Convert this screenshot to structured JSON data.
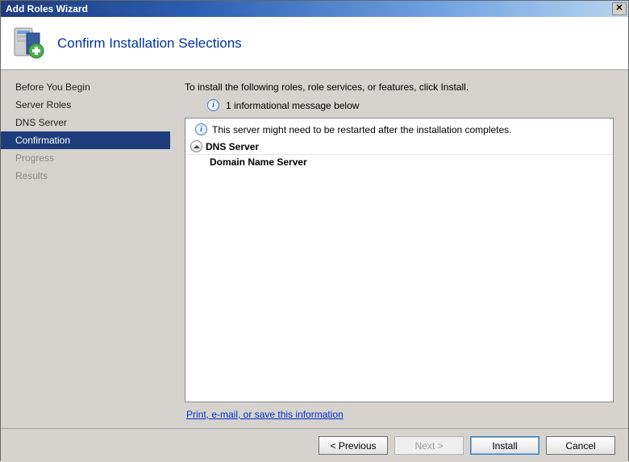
{
  "window": {
    "title": "Add Roles Wizard"
  },
  "header": {
    "title": "Confirm Installation Selections"
  },
  "sidebar": {
    "items": [
      {
        "label": "Before You Begin",
        "state": "normal"
      },
      {
        "label": "Server Roles",
        "state": "normal"
      },
      {
        "label": "DNS Server",
        "state": "normal"
      },
      {
        "label": "Confirmation",
        "state": "selected"
      },
      {
        "label": "Progress",
        "state": "disabled"
      },
      {
        "label": "Results",
        "state": "disabled"
      }
    ]
  },
  "main": {
    "intro": "To install the following roles, role services, or features, click Install.",
    "info_count": "1 informational message below",
    "restart_msg": "This server might need to be restarted after the installation completes.",
    "role_heading": "DNS Server",
    "role_sub": "Domain Name Server",
    "save_link": "Print, e-mail, or save this information"
  },
  "footer": {
    "previous": "< Previous",
    "next": "Next >",
    "install": "Install",
    "cancel": "Cancel"
  }
}
